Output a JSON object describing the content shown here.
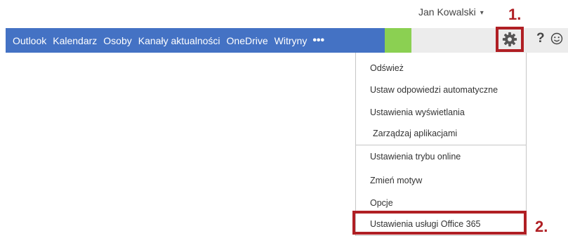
{
  "nav": {
    "items": [
      "Outlook",
      "Kalendarz",
      "Osoby",
      "Kanały aktualności",
      "OneDrive",
      "Witryny"
    ],
    "more_label": "•••"
  },
  "user": {
    "name": "Jan Kowalski",
    "caret": "▾"
  },
  "toolbar": {
    "help_label": "?"
  },
  "menu": {
    "items": [
      "Odśwież",
      "Ustaw odpowiedzi automatyczne",
      "Ustawienia wyświetlania",
      "Zarządzaj aplikacjami",
      "Ustawienia trybu online",
      "Zmień motyw",
      "Opcje",
      "Ustawienia usługi Office 365"
    ]
  },
  "annotations": {
    "step1": "1.",
    "step2": "2."
  },
  "colors": {
    "nav_blue": "#4472c4",
    "nav_green": "#8bd052",
    "nav_gray": "#ececec",
    "highlight_red": "#b01f24"
  },
  "icons": {
    "settings": "gear-icon",
    "help": "help-icon",
    "feedback": "smiley-icon",
    "more": "more-icon"
  }
}
